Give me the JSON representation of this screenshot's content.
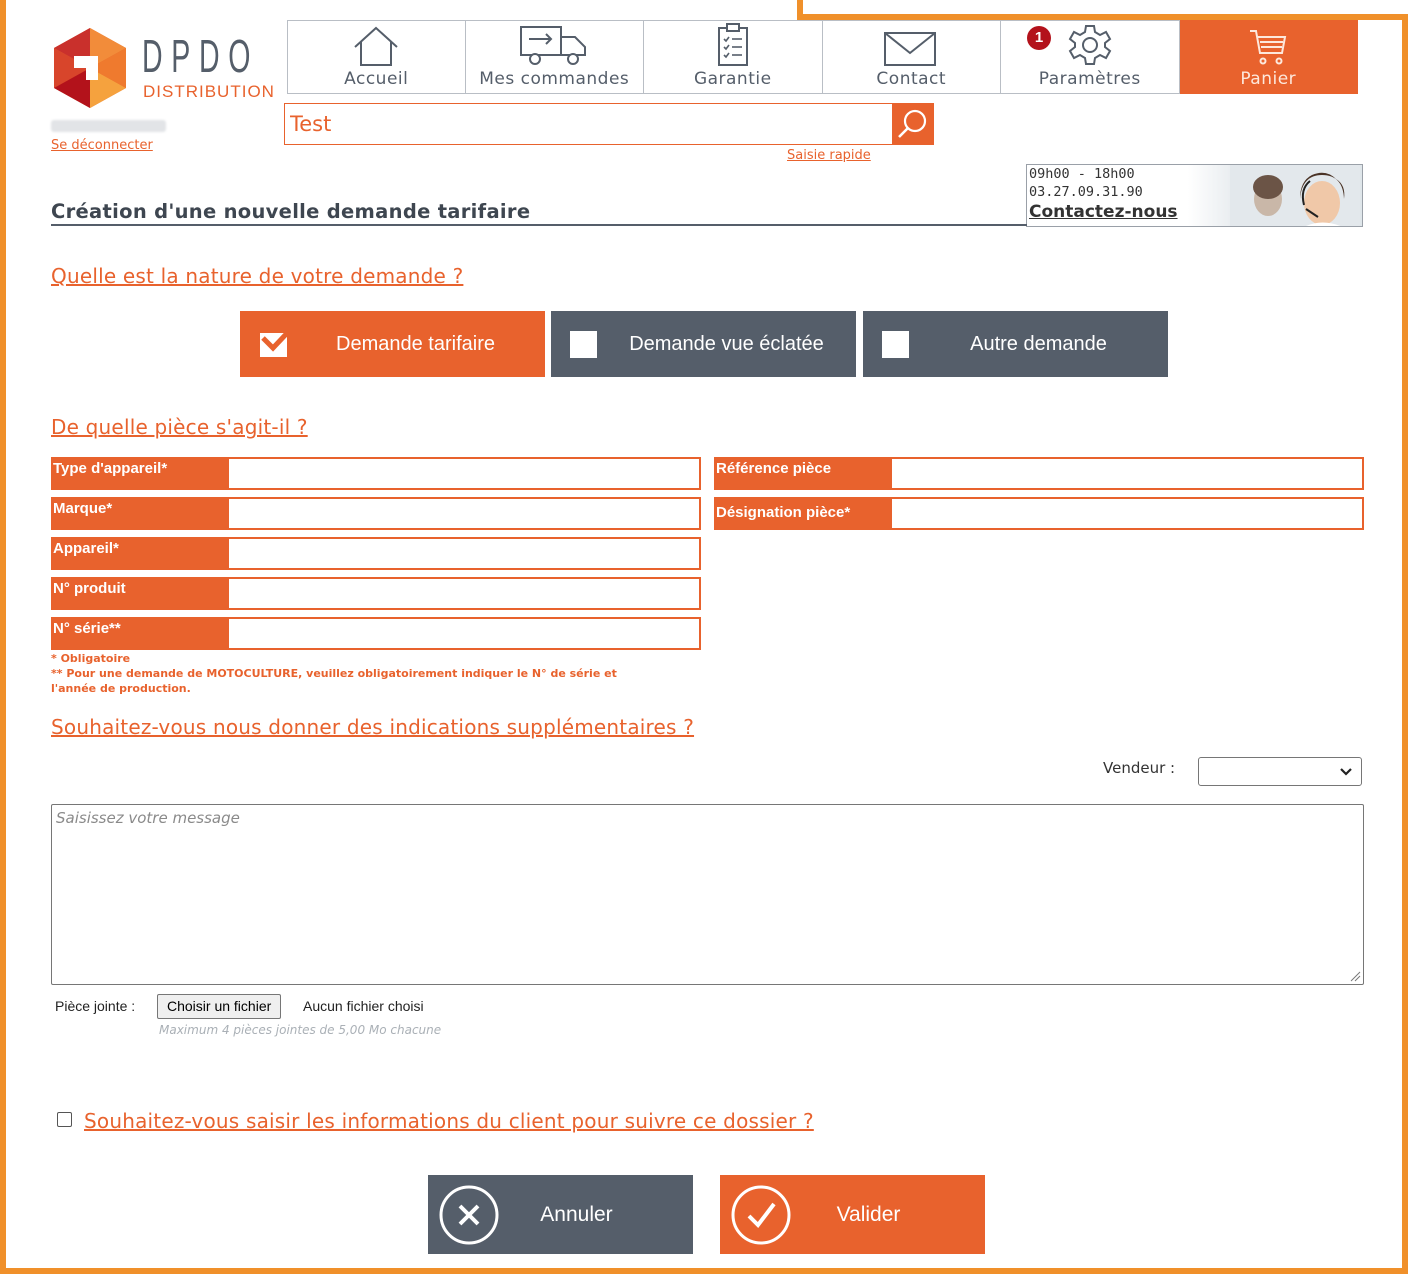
{
  "colors": {
    "brand_orange": "#e8622d",
    "frame_orange": "#f0902a",
    "slate": "#555e6a",
    "badge_red": "#b3121b"
  },
  "logo": {
    "name": "DPDO",
    "sub": "DISTRIBUTION"
  },
  "user": {
    "logout_label": "Se déconnecter"
  },
  "nav": {
    "items": [
      {
        "label": "Accueil",
        "icon": "home-icon"
      },
      {
        "label": "Mes commandes",
        "icon": "truck-icon"
      },
      {
        "label": "Garantie",
        "icon": "clipboard-icon"
      },
      {
        "label": "Contact",
        "icon": "mail-icon"
      },
      {
        "label": "Paramètres",
        "icon": "gear-icon"
      },
      {
        "label": "Panier",
        "icon": "cart-icon",
        "active": true
      }
    ],
    "contact_badge": "1"
  },
  "search": {
    "value": "Test",
    "quick_link": "Saisie rapide"
  },
  "contact_box": {
    "hours": "09h00 - 18h00",
    "phone": "03.27.09.31.90",
    "link": "Contactez-nous"
  },
  "page": {
    "title": "Création d'une nouvelle demande tarifaire"
  },
  "sections": {
    "nature": "Quelle est la nature de votre demande ?",
    "piece": "De quelle pièce s'agit-il ?",
    "indications": "Souhaitez-vous nous donner des indications supplémentaires ?"
  },
  "request_types": [
    {
      "label": "Demande tarifaire",
      "checked": true
    },
    {
      "label": "Demande vue éclatée",
      "checked": false
    },
    {
      "label": "Autre demande",
      "checked": false
    }
  ],
  "fields_left": [
    {
      "label": "Type d'appareil*",
      "value": ""
    },
    {
      "label": "Marque*",
      "value": ""
    },
    {
      "label": "Appareil*",
      "value": ""
    },
    {
      "label": "N° produit",
      "value": ""
    },
    {
      "label": "N° série**",
      "value": ""
    }
  ],
  "fields_right": [
    {
      "label": "Référence pièce",
      "value": ""
    },
    {
      "label": "Désignation pièce*",
      "value": ""
    }
  ],
  "notes": {
    "required": "* Obligatoire",
    "moto_line1": "** Pour une demande de MOTOCULTURE, veuillez obligatoirement indiquer le N° de série et",
    "moto_line2": "l'année de production."
  },
  "vendeur": {
    "label": "Vendeur :",
    "selected": ""
  },
  "message": {
    "placeholder": "Saisissez votre message",
    "value": ""
  },
  "attachment": {
    "label": "Pièce jointe :",
    "button": "Choisir un fichier",
    "status": "Aucun fichier choisi",
    "hint": "Maximum 4 pièces jointes de 5,00 Mo chacune"
  },
  "client_question": {
    "label": "Souhaitez-vous saisir les informations du client pour suivre ce dossier ?",
    "checked": false
  },
  "actions": {
    "cancel": "Annuler",
    "submit": "Valider"
  }
}
